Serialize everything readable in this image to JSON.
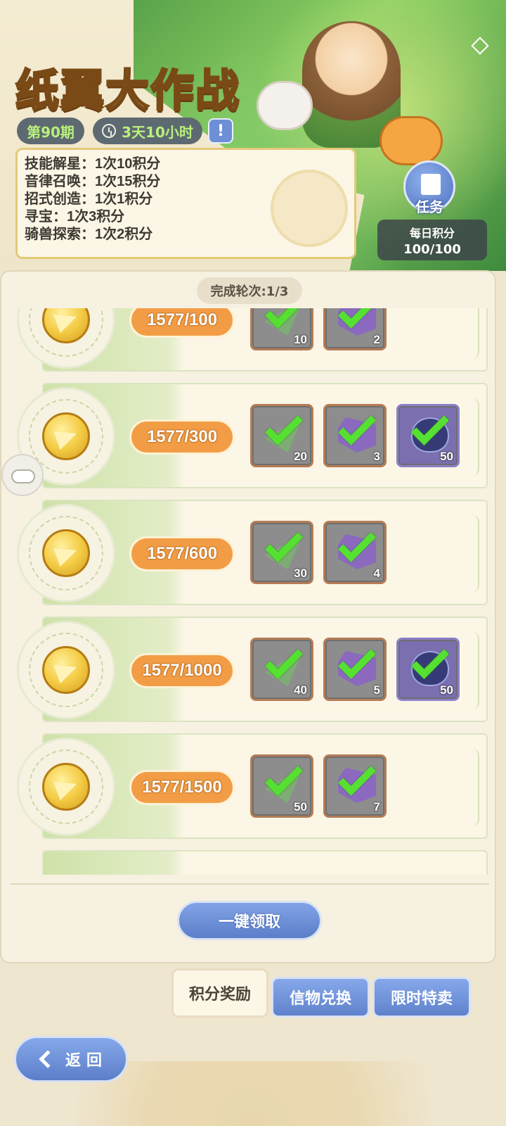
{
  "event": {
    "title": "纸翼大作战",
    "period": "第90期",
    "countdown": "3天10小时",
    "info_label": "!"
  },
  "rules": [
    "技能解星：1次10积分",
    "音律召唤：1次15积分",
    "招式创造：1次1积分",
    "寻宝：1次3积分",
    "骑兽探索：1次2积分"
  ],
  "task": {
    "label": "任务",
    "daily_title": "每日积分",
    "daily_value": "100/100"
  },
  "round_label": "完成轮次:1/3",
  "tiers": [
    {
      "progress": "1577/100",
      "rewards": [
        {
          "item": "plane",
          "qty": "10",
          "claimed": true
        },
        {
          "item": "cube",
          "qty": "2",
          "claimed": true
        }
      ]
    },
    {
      "progress": "1577/300",
      "rewards": [
        {
          "item": "plane",
          "qty": "20",
          "claimed": true
        },
        {
          "item": "cube",
          "qty": "3",
          "claimed": true
        },
        {
          "item": "egg",
          "qty": "50",
          "claimed": true
        }
      ]
    },
    {
      "progress": "1577/600",
      "rewards": [
        {
          "item": "plane",
          "qty": "30",
          "claimed": true
        },
        {
          "item": "cube",
          "qty": "4",
          "claimed": true
        }
      ]
    },
    {
      "progress": "1577/1000",
      "rewards": [
        {
          "item": "plane",
          "qty": "40",
          "claimed": true
        },
        {
          "item": "cube",
          "qty": "5",
          "claimed": true
        },
        {
          "item": "egg",
          "qty": "50",
          "claimed": true
        }
      ]
    },
    {
      "progress": "1577/1500",
      "rewards": [
        {
          "item": "plane",
          "qty": "50",
          "claimed": true
        },
        {
          "item": "cube",
          "qty": "7",
          "claimed": true
        }
      ]
    }
  ],
  "claim_all_label": "一键领取",
  "tabs": [
    {
      "label": "积分奖励",
      "active": true
    },
    {
      "label": "信物兑换",
      "active": false
    },
    {
      "label": "限时特卖",
      "active": false
    }
  ],
  "back_label": "返回",
  "colors": {
    "progress_pill": "#f29d45",
    "check": "#55e032",
    "accent_blue": "#5f82cc"
  }
}
